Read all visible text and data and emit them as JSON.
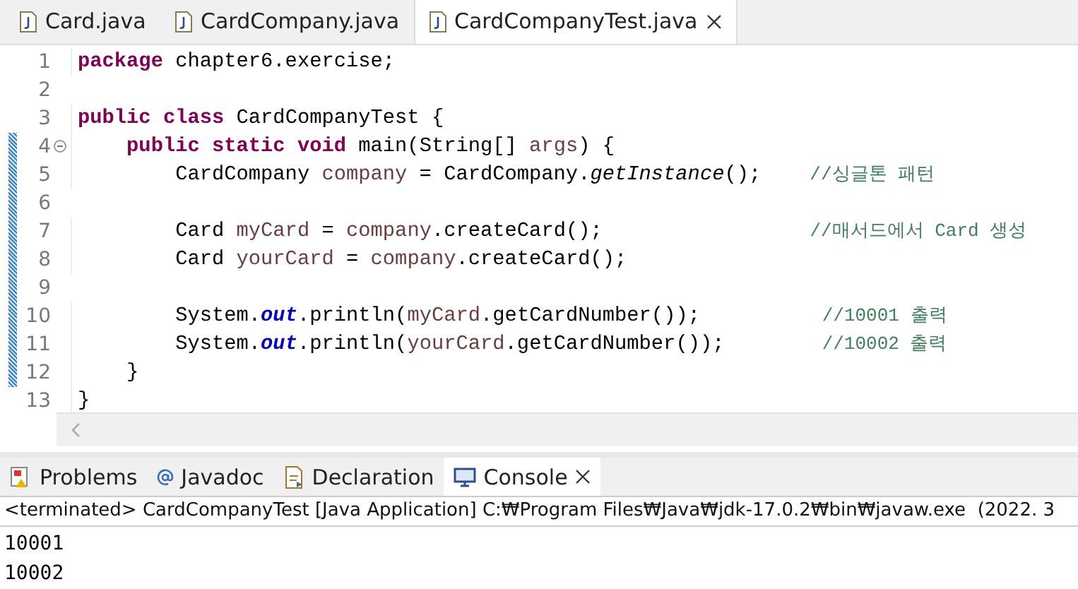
{
  "editor_tabs": [
    {
      "label": "Card.java",
      "selected": false
    },
    {
      "label": "CardCompany.java",
      "selected": false
    },
    {
      "label": "CardCompanyTest.java",
      "selected": true
    }
  ],
  "code_lines": [
    {
      "number": "1",
      "changed": false,
      "folding": false,
      "tokens": [
        {
          "kind": "keyword",
          "text": "package"
        },
        {
          "kind": "plain",
          "text": " chapter6.exercise;"
        }
      ]
    },
    {
      "number": "2",
      "changed": false,
      "folding": false
    },
    {
      "number": "3",
      "changed": false,
      "folding": false,
      "tokens": [
        {
          "kind": "keyword",
          "text": "public class"
        },
        {
          "kind": "plain",
          "text": " CardCompanyTest {"
        }
      ]
    },
    {
      "number": "4",
      "changed": true,
      "folding": true,
      "tokens": [
        {
          "kind": "keyword",
          "text": "    public static void"
        },
        {
          "kind": "plain",
          "text": " main(String[] "
        },
        {
          "kind": "local",
          "text": "args"
        },
        {
          "kind": "plain",
          "text": ") {"
        }
      ]
    },
    {
      "number": "5",
      "changed": true,
      "folding": false,
      "tokens": [
        {
          "kind": "plain",
          "text": "        CardCompany "
        },
        {
          "kind": "local",
          "text": "company"
        },
        {
          "kind": "plain",
          "text": " = CardCompany."
        },
        {
          "kind": "static",
          "text": "getInstance"
        },
        {
          "kind": "plain",
          "text": "();    "
        },
        {
          "kind": "comment",
          "text": "//싱글톤 패턴"
        }
      ]
    },
    {
      "number": "6",
      "changed": true,
      "folding": false
    },
    {
      "number": "7",
      "changed": true,
      "folding": false,
      "tokens": [
        {
          "kind": "plain",
          "text": "        Card "
        },
        {
          "kind": "local",
          "text": "myCard"
        },
        {
          "kind": "plain",
          "text": " = "
        },
        {
          "kind": "local",
          "text": "company"
        },
        {
          "kind": "plain",
          "text": ".createCard();                 "
        },
        {
          "kind": "comment",
          "text": "//매서드에서 Card 생성"
        }
      ]
    },
    {
      "number": "8",
      "changed": true,
      "folding": false,
      "tokens": [
        {
          "kind": "plain",
          "text": "        Card "
        },
        {
          "kind": "local",
          "text": "yourCard"
        },
        {
          "kind": "plain",
          "text": " = "
        },
        {
          "kind": "local",
          "text": "company"
        },
        {
          "kind": "plain",
          "text": ".createCard();"
        }
      ]
    },
    {
      "number": "9",
      "changed": true,
      "folding": false
    },
    {
      "number": "10",
      "changed": true,
      "folding": false,
      "tokens": [
        {
          "kind": "plain",
          "text": "        System."
        },
        {
          "kind": "field",
          "text": "out"
        },
        {
          "kind": "plain",
          "text": ".println("
        },
        {
          "kind": "local",
          "text": "myCard"
        },
        {
          "kind": "plain",
          "text": ".getCardNumber());          "
        },
        {
          "kind": "comment",
          "text": "//10001 출력"
        }
      ]
    },
    {
      "number": "11",
      "changed": true,
      "folding": false,
      "tokens": [
        {
          "kind": "plain",
          "text": "        System."
        },
        {
          "kind": "field",
          "text": "out"
        },
        {
          "kind": "plain",
          "text": ".println("
        },
        {
          "kind": "local",
          "text": "yourCard"
        },
        {
          "kind": "plain",
          "text": ".getCardNumber());        "
        },
        {
          "kind": "comment",
          "text": "//10002 출력"
        }
      ]
    },
    {
      "number": "12",
      "changed": true,
      "folding": false,
      "tokens": [
        {
          "kind": "plain",
          "text": "    }"
        }
      ]
    },
    {
      "number": "13",
      "changed": false,
      "folding": false,
      "tokens": [
        {
          "kind": "plain",
          "text": "}"
        }
      ]
    }
  ],
  "panel_tabs": [
    {
      "label": "Problems",
      "kind": "problems",
      "selected": false
    },
    {
      "label": "Javadoc",
      "kind": "javadoc",
      "selected": false
    },
    {
      "label": "Declaration",
      "kind": "declaration",
      "selected": false
    },
    {
      "label": "Console",
      "kind": "console",
      "selected": true
    }
  ],
  "console": {
    "header": "<terminated> CardCompanyTest [Java Application] C:₩Program Files₩Java₩jdk-17.0.2₩bin₩javaw.exe  (2022. 3",
    "output": [
      "10001",
      "10002"
    ]
  }
}
